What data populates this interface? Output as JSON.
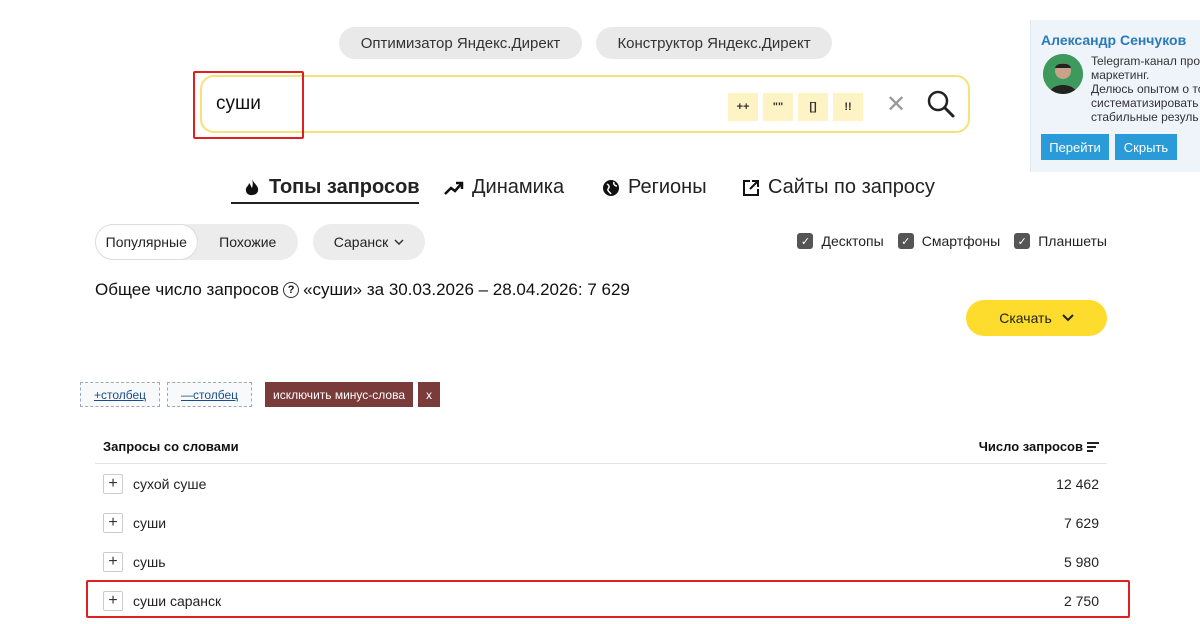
{
  "top_buttons": {
    "optimizer": "Оптимизатор Яндекс.Директ",
    "constructor": "Конструктор Яндекс.Директ"
  },
  "search": {
    "value": "суши",
    "operators": [
      "++",
      "\"\"",
      "[]",
      "!!"
    ]
  },
  "tabs": [
    {
      "label": "Топы запросов",
      "icon": "fire-icon"
    },
    {
      "label": "Динамика",
      "icon": "trend-icon"
    },
    {
      "label": "Регионы",
      "icon": "globe-icon"
    },
    {
      "label": "Сайты по запросу",
      "icon": "external-link-icon"
    }
  ],
  "filters": {
    "segments": [
      "Популярные",
      "Похожие"
    ],
    "region": "Саранск",
    "devices": [
      "Десктопы",
      "Смартфоны",
      "Планшеты"
    ]
  },
  "total": {
    "prefix": "Общее число запросов",
    "text": "«суши» за 30.03.2026 – 28.04.2026: 7 629"
  },
  "download_label": "Скачать",
  "column_controls": {
    "add": "+столбец",
    "remove": "—столбец",
    "exclude": "исключить минус-слова",
    "close": "x"
  },
  "table": {
    "col_query": "Запросы со словами",
    "col_count": "Число запросов",
    "rows": [
      {
        "query": "сухой суше",
        "count": "12 462"
      },
      {
        "query": "суши",
        "count": "7 629"
      },
      {
        "query": "сушь",
        "count": "5 980"
      },
      {
        "query": "суши саранск",
        "count": "2 750"
      }
    ]
  },
  "promo": {
    "name": "Александр Сенчуков",
    "lines": [
      "Telegram-канал про",
      "маркетинг.",
      "Делюсь опытом о то",
      "систематизировать",
      "стабильные резуль"
    ],
    "go": "Перейти",
    "hide": "Скрыть"
  },
  "colors": {
    "accent_yellow": "#fddc2d",
    "highlight_red": "#e02020",
    "link_blue": "#2a9bd9",
    "minus_brown": "#7a3b3b"
  }
}
